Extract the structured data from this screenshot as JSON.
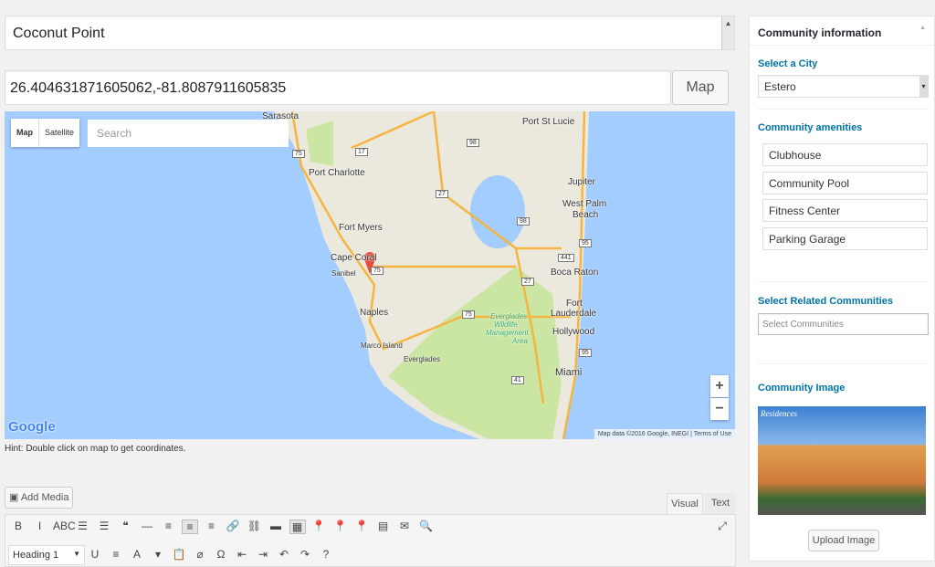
{
  "title_field": {
    "value": "Coconut Point"
  },
  "coords_field": {
    "value": "26.404631871605062,-81.8087911605835"
  },
  "map_button": "Map",
  "map": {
    "type_map": "Map",
    "type_satellite": "Satellite",
    "search_placeholder": "Search",
    "zoom_in": "+",
    "zoom_out": "−",
    "logo": "Google",
    "attribution": "Map data ©2016 Google, INEGI",
    "terms": "Terms of Use",
    "colors": {
      "water": "#a3ccff",
      "land": "#ebe8de",
      "park": "#cbe6a3",
      "highway": "#f5b53f"
    },
    "labels": [
      "Sarasota",
      "Port St Lucie",
      "Port Charlotte",
      "Jupiter",
      "West Palm",
      "Beach",
      "Fort Myers",
      "Cape Coral",
      "Sanibel",
      "Boca Raton",
      "Fort",
      "Lauderdale",
      "Naples",
      "Everglades",
      "Wildlife",
      "Management",
      "Area",
      "Hollywood",
      "Marco Island",
      "Everglades",
      "Miami"
    ],
    "shields": [
      "75",
      "17",
      "98",
      "27",
      "98",
      "441",
      "95",
      "75",
      "27",
      "41",
      "75",
      "95"
    ]
  },
  "hint": "Hint: Double click on map to get coordinates.",
  "editor": {
    "add_media": "Add Media",
    "tab_visual": "Visual",
    "tab_text": "Text",
    "format_select": "Heading 1",
    "row1": [
      "B",
      "I",
      "ABC",
      "☰",
      "☰",
      "❝",
      "—",
      "≡",
      "≡",
      "≡",
      "🔗",
      "⛓",
      "▬",
      "▦",
      "📍",
      "📍",
      "📍",
      "▤",
      "✉",
      "🔍"
    ],
    "row2": [
      "U",
      "≡",
      "A",
      "▾",
      "📋",
      "⌀",
      "Ω",
      "⇤",
      "⇥",
      "↶",
      "↷",
      "?"
    ]
  },
  "sidebar": {
    "title": "Community information",
    "select_city_label": "Select a City",
    "city_value": "Estero",
    "amenities_label": "Community amenities",
    "amenities": [
      "Clubhouse",
      "Community Pool",
      "Fitness Center",
      "Parking Garage"
    ],
    "related_label": "Select Related Communities",
    "related_placeholder": "Select Communities",
    "image_label": "Community Image",
    "image_logo_text": "Residences",
    "upload_button": "Upload Image"
  }
}
